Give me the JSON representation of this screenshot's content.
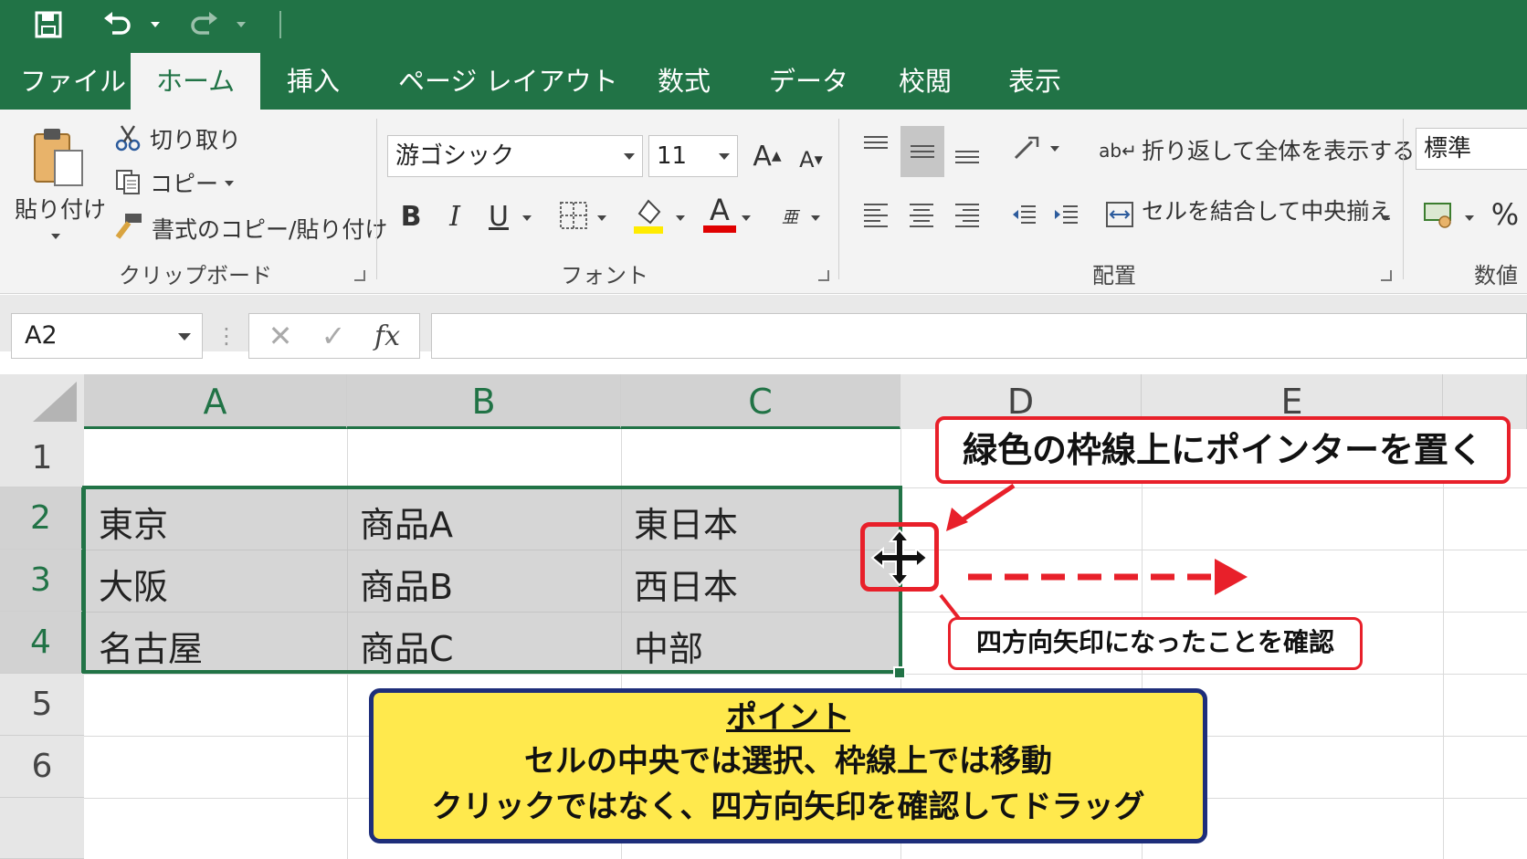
{
  "quick_access": {
    "icons": [
      "save-icon",
      "undo-icon",
      "redo-icon"
    ]
  },
  "tabs": [
    {
      "label": "ファイル"
    },
    {
      "label": "ホーム",
      "active": true
    },
    {
      "label": "挿入"
    },
    {
      "label": "ページ レイアウト"
    },
    {
      "label": "数式"
    },
    {
      "label": "データ"
    },
    {
      "label": "校閲"
    },
    {
      "label": "表示"
    }
  ],
  "ribbon": {
    "clipboard": {
      "paste_label": "貼り付け",
      "cut_label": "切り取り",
      "copy_label": "コピー",
      "format_painter_label": "書式のコピー/貼り付け",
      "group_label": "クリップボード"
    },
    "font": {
      "font_name": "游ゴシック",
      "font_size": "11",
      "bold": "B",
      "italic": "I",
      "underline": "U",
      "group_label": "フォント",
      "highlight_color": "#ffeb00",
      "font_color": "#e00000"
    },
    "alignment": {
      "wrap_text_label": "折り返して全体を表示する",
      "merge_center_label": "セルを結合して中央揃え",
      "group_label": "配置"
    },
    "number": {
      "format": "標準",
      "percent": "%",
      "group_label": "数値"
    }
  },
  "formula_bar": {
    "name_box": "A2",
    "fx": "fx",
    "value": ""
  },
  "grid": {
    "columns": [
      "A",
      "B",
      "C",
      "D",
      "E"
    ],
    "selected_columns": [
      "A",
      "B",
      "C"
    ],
    "rows": [
      "1",
      "2",
      "3",
      "4",
      "5",
      "6"
    ],
    "selected_rows": [
      "2",
      "3",
      "4"
    ],
    "cells": [
      [
        "東京",
        "商品A",
        "東日本"
      ],
      [
        "大阪",
        "商品B",
        "西日本"
      ],
      [
        "名古屋",
        "商品C",
        "中部"
      ]
    ]
  },
  "annotations": {
    "top_callout": "緑色の枠線上にポインターを置く",
    "small_callout": "四方向矢印になったことを確認",
    "point_title": "ポイント",
    "point_line1": "セルの中央では選択、枠線上では移動",
    "point_line2": "クリックではなく、四方向矢印を確認してドラッグ",
    "accent_color": "#e8202a",
    "excel_green": "#217346"
  }
}
